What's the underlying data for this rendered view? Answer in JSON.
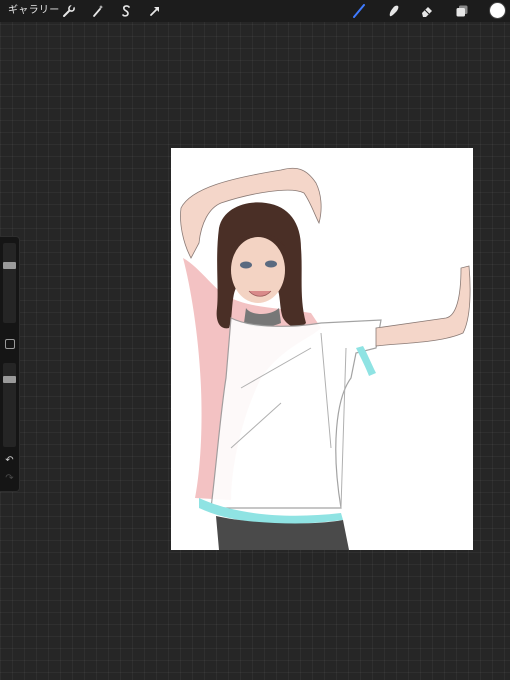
{
  "topbar": {
    "gallery_label": "ギャラリー",
    "left_tools": [
      "wrench-icon",
      "magic-wand-icon",
      "selection-icon",
      "transform-arrow-icon"
    ],
    "right_tools": [
      "brush-icon",
      "smudge-icon",
      "eraser-icon",
      "layers-icon"
    ],
    "active_tool": "brush-icon",
    "active_color": "#3f7bff",
    "current_color": "#ffffff"
  },
  "sidebar": {
    "brush_size_level": 0.35,
    "opacity_level": 0.15,
    "modify_icon": "square-icon",
    "undo_icon": "↶",
    "redo_icon": "↷"
  },
  "canvas": {
    "background": "#ffffff",
    "subject": "sketch-figure"
  }
}
